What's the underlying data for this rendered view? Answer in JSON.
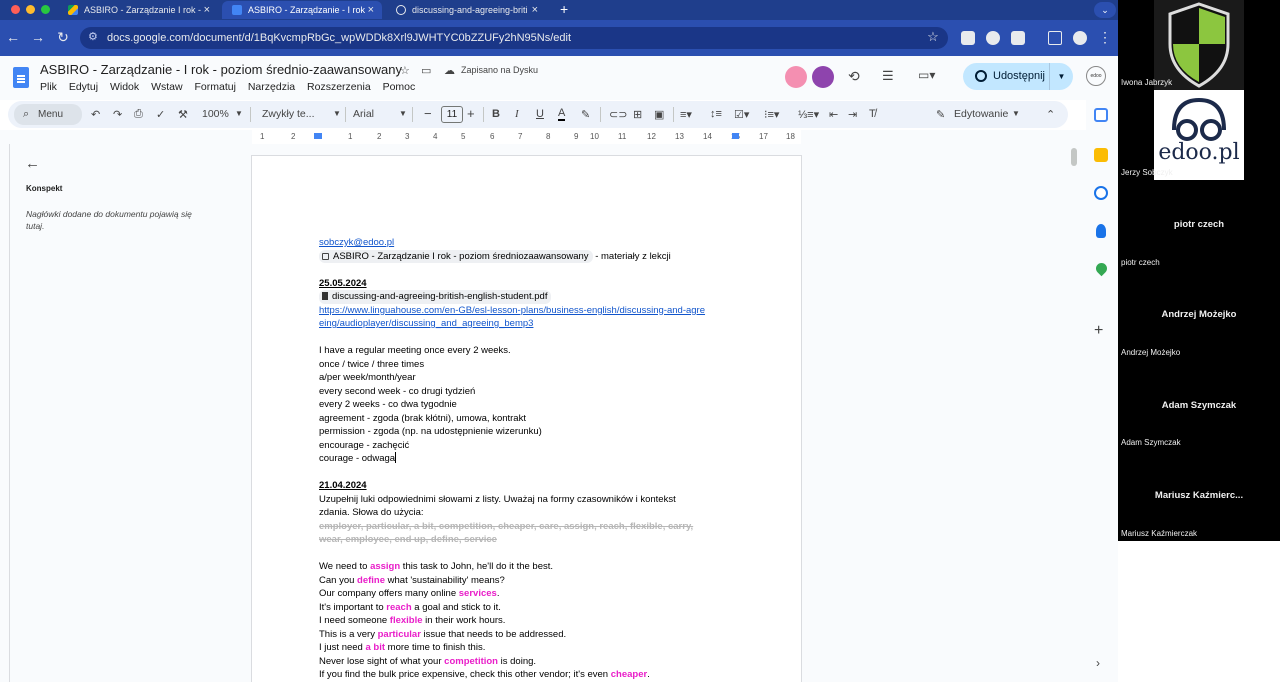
{
  "browser": {
    "tabs": [
      {
        "title": "ASBIRO - Zarządzanie I rok -",
        "active": false
      },
      {
        "title": "ASBIRO - Zarządzanie - I rok",
        "active": true
      },
      {
        "title": "discussing-and-agreeing-briti",
        "active": false
      }
    ],
    "url": "docs.google.com/document/d/1BqKvcmpRbGc_wpWDDk8Xrl9JWHTYC0bZZUFy2hN95Ns/edit"
  },
  "docs": {
    "title": "ASBIRO - Zarządzanie - I rok - poziom średnio-zaawansowany",
    "save_status": "Zapisano na Dysku",
    "menu": [
      "Plik",
      "Edytuj",
      "Widok",
      "Wstaw",
      "Formatuj",
      "Narzędzia",
      "Rozszerzenia",
      "Pomoc"
    ],
    "share_label": "Udostępnij",
    "toolbar": {
      "menu_search": "Menu",
      "zoom": "100%",
      "style": "Zwykły te...",
      "font": "Arial",
      "font_size": "11",
      "mode": "Edytowanie"
    },
    "ruler_numbers": [
      "1",
      "2",
      "1",
      "2",
      "3",
      "4",
      "5",
      "6",
      "7",
      "8",
      "9",
      "10",
      "11",
      "12",
      "13",
      "14",
      "15",
      "16",
      "17",
      "18"
    ],
    "outline": {
      "title": "Konspekt",
      "hint": "Nagłówki dodane do dokumentu pojawią się tutaj."
    }
  },
  "document": {
    "email": "sobczyk@edoo.pl",
    "chip1": "ASBIRO - Zarządzanie I rok - poziom średniozaawansowany",
    "chip1_suffix": " - materiały z lekcji",
    "date1": "25.05.2024",
    "chip2": "discussing-and-agreeing-british-english-student.pdf",
    "link_line1": "https://www.linguahouse.com/en-GB/esl-lesson-plans/business-english/discussing-and-agre",
    "link_line2": "eing/audioplayer/discussing_and_agreeing_bemp3",
    "notes": [
      "I have a regular meeting once every 2 weeks.",
      "once / twice / three times",
      "a/per week/month/year",
      "every second week - co drugi tydzień",
      "every 2 weeks - co dwa tygodnie",
      "agreement - zgoda (brak kłótni), umowa, kontrakt",
      "permission - zgoda (np. na udostępnienie wizerunku)",
      "encourage - zachęcić",
      "courage - odwaga"
    ],
    "date2": "21.04.2024",
    "instruction_line1": "Uzupełnij luki odpowiednimi słowami z listy. Uważaj na formy czasowników i kontekst",
    "instruction_line2": "zdania. Słowa do użycia:",
    "struck_line1": "employer, particular, a bit, competition, cheaper, care, assign, reach, flexible, carry,",
    "struck_line2": "wear, employee, end up, define, service",
    "sentences": [
      {
        "before": "We need to ",
        "word": "assign",
        "after": " this task to John, he'll do it the best."
      },
      {
        "before": "Can you ",
        "word": "define",
        "after": " what 'sustainability' means?"
      },
      {
        "before": "Our company offers many online ",
        "word": "services",
        "after": "."
      },
      {
        "before": "It's important to ",
        "word": "reach",
        "after": " a goal and stick to it."
      },
      {
        "before": "I need someone ",
        "word": "flexible",
        "after": " in their work hours."
      },
      {
        "before": "This is a very ",
        "word": "particular",
        "after": " issue that needs to be addressed."
      },
      {
        "before": "I just need ",
        "word": "a bit",
        "after": " more time to finish this."
      },
      {
        "before": "Never lose sight of what your ",
        "word": "competition",
        "after": " is doing."
      },
      {
        "before": "If you find the bulk price expensive, check this other vendor; it's even ",
        "word": "cheaper",
        "after": "."
      }
    ]
  },
  "meeting": {
    "participants": [
      {
        "name": "Iwona Jabrzyk"
      },
      {
        "name": "Jerzy Sobczyk"
      },
      {
        "big": "piotr czech",
        "name": "piotr czech"
      },
      {
        "big": "Andrzej Możejko",
        "name": "Andrzej Możejko"
      },
      {
        "big": "Adam Szymczak",
        "name": "Adam Szymczak"
      },
      {
        "big": "Mariusz  Kaźmierc...",
        "name": "Mariusz Kaźmierczak"
      }
    ],
    "logo_text": "edoo.pl"
  },
  "colors": {
    "tab_strip": "#1f3e8c",
    "nav_bar": "#2b4fb0",
    "highlight_word": "#e91ec9",
    "link": "#1155cc",
    "share_button": "#c2e7ff"
  }
}
